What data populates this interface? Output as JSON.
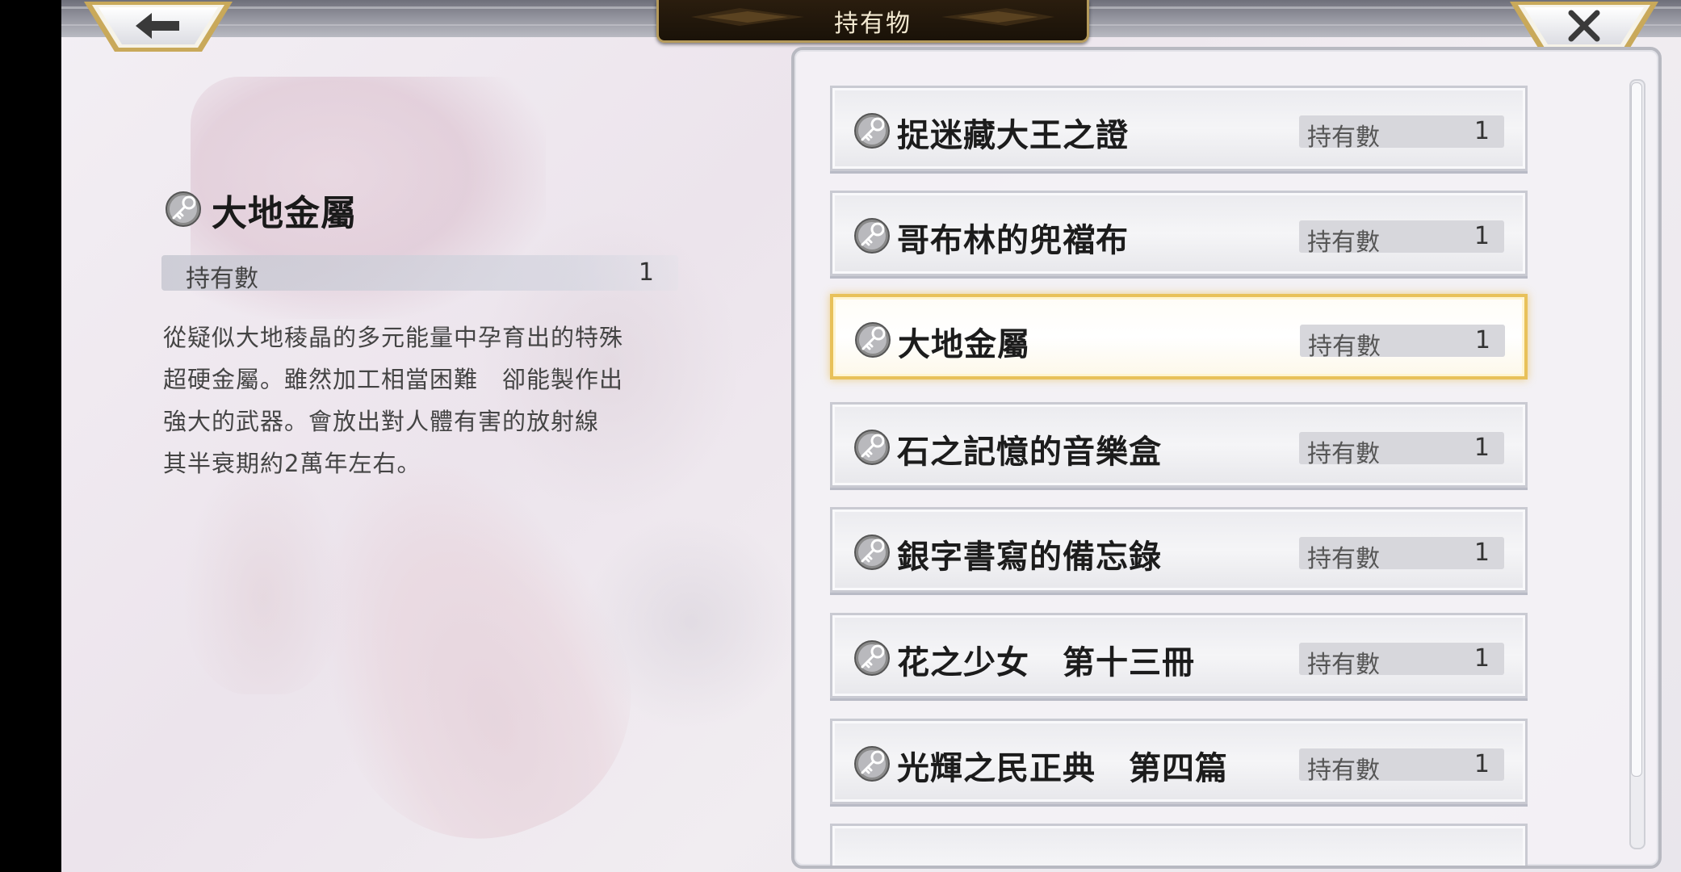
{
  "header": {
    "title": "持有物",
    "back_icon": "arrow-left-icon",
    "close_icon": "close-icon"
  },
  "detail": {
    "name": "大地金屬",
    "icon": "key-icon",
    "count_label": "持有數",
    "count_value": "1",
    "description_lines": [
      "從疑似大地稜晶的多元能量中孕育出的特殊",
      "超硬金屬。雖然加工相當困難　卻能製作出",
      "強大的武器。會放出對人體有害的放射線",
      "其半衰期約2萬年左右。"
    ]
  },
  "list": {
    "items": [
      {
        "name": "捉迷藏大王之證",
        "count_label": "持有數",
        "count": "1",
        "icon": "key-icon",
        "selected": false
      },
      {
        "name": "哥布林的兜襠布",
        "count_label": "持有數",
        "count": "1",
        "icon": "key-icon",
        "selected": false
      },
      {
        "name": "大地金屬",
        "count_label": "持有數",
        "count": "1",
        "icon": "key-icon",
        "selected": true
      },
      {
        "name": "石之記憶的音樂盒",
        "count_label": "持有數",
        "count": "1",
        "icon": "key-icon",
        "selected": false
      },
      {
        "name": "銀字書寫的備忘錄",
        "count_label": "持有數",
        "count": "1",
        "icon": "key-icon",
        "selected": false
      },
      {
        "name": "花之少女　第十三冊",
        "count_label": "持有數",
        "count": "1",
        "icon": "key-icon",
        "selected": false
      },
      {
        "name": "光輝之民正典　第四篇",
        "count_label": "持有數",
        "count": "1",
        "icon": "key-icon",
        "selected": false
      }
    ]
  },
  "colors": {
    "selected_border": "#e8c15a",
    "title_plate": "#1a1208",
    "title_text": "#f4ead2"
  }
}
